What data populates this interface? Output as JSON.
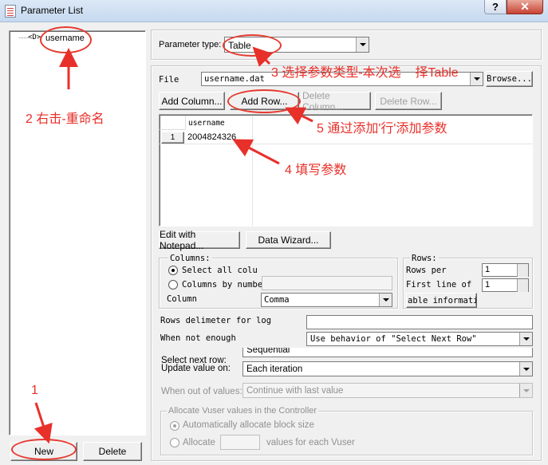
{
  "window": {
    "title": "Parameter List",
    "help_label": "?",
    "close_label": "✕"
  },
  "tree": {
    "item_label": "username",
    "item_icon": "parameter-icon"
  },
  "left_buttons": {
    "new_label": "New",
    "delete_label": "Delete"
  },
  "param_type": {
    "label": "Parameter type:",
    "value": "Table"
  },
  "file": {
    "label": "File",
    "value": "username.dat",
    "browse_label": "Browse..."
  },
  "table_buttons": {
    "add_column": "Add Column...",
    "add_row": "Add Row...",
    "delete_column": "Delete Column...",
    "delete_row": "Delete Row..."
  },
  "grid": {
    "header": "username",
    "rows": [
      {
        "num": "1",
        "value": "2004824326"
      }
    ]
  },
  "bottom_buttons": {
    "edit_notepad": "Edit with Notepad...",
    "data_wizard": "Data Wizard..."
  },
  "columns_group": {
    "title": "Columns:",
    "select_all": "Select all colu",
    "by_number": "Columns by numbe",
    "column_label": "Column",
    "column_value": "Comma"
  },
  "rows_group": {
    "title": "Rows:",
    "rows_per": "Rows per",
    "rows_per_value": "1",
    "first_line": "First line of",
    "first_line_value": "1",
    "table_info": "able informatic"
  },
  "rows_delimiter": {
    "label": "Rows delimeter for log",
    "value": ""
  },
  "when_not_enough": {
    "label": "When not enough",
    "value": "Use behavior of \"Select Next Row\""
  },
  "select_next": {
    "label": "Select next row:",
    "value": "Sequential"
  },
  "update_value": {
    "label": "Update value on:",
    "value": "Each iteration"
  },
  "out_of_values": {
    "label": "When out of values:",
    "value": "Continue with last value"
  },
  "allocate": {
    "title": "Allocate Vuser values in the Controller",
    "auto": "Automatically allocate block size",
    "manual": "Allocate",
    "manual_suffix": "values for each Vuser"
  },
  "annotations": {
    "a1": "1",
    "a2": "2 右击-重命名",
    "a3": "3 选择参数类型-本次选    择Table",
    "a4": "4 填写参数",
    "a5": "5 通过添加'行'添加参数"
  },
  "colors": {
    "annotation": "#e8302a",
    "title_bar": "#c6d9ef",
    "close": "#c74232"
  }
}
